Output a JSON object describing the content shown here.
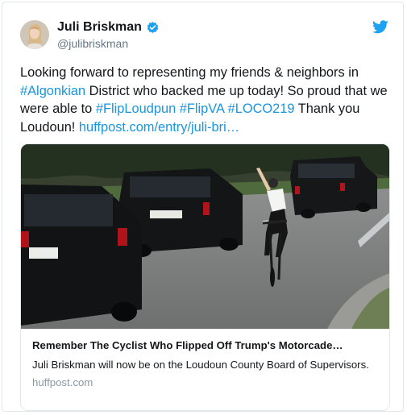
{
  "user": {
    "name": "Juli Briskman",
    "handle": "@julibriskman"
  },
  "tweet": {
    "segments": [
      {
        "text": "Looking forward to representing my friends & neighbors in ",
        "link": false
      },
      {
        "text": "#Algonkian",
        "link": true
      },
      {
        "text": " District who backed me up today! So proud  that we were able to ",
        "link": false
      },
      {
        "text": "#FlipLoudpun",
        "link": true
      },
      {
        "text": " ",
        "link": false
      },
      {
        "text": "#FlipVA",
        "link": true
      },
      {
        "text": " ",
        "link": false
      },
      {
        "text": "#LOCO219",
        "link": true
      },
      {
        "text": " Thank you Loudoun! ",
        "link": false
      },
      {
        "text": "huffpost.com/entry/juli-bri…",
        "link": true
      }
    ]
  },
  "card": {
    "title": "Remember The Cyclist Who Flipped Off Trump's Motorcade…",
    "description": "Juli Briskman will now be on the Loudoun County Board of Supervisors.",
    "domain": "huffpost.com"
  },
  "icons": {
    "verified": "verified-badge-icon",
    "brand": "twitter-bird-icon"
  },
  "colors": {
    "link": "#1b95e0",
    "verified": "#1da1f2",
    "muted": "#657786"
  }
}
